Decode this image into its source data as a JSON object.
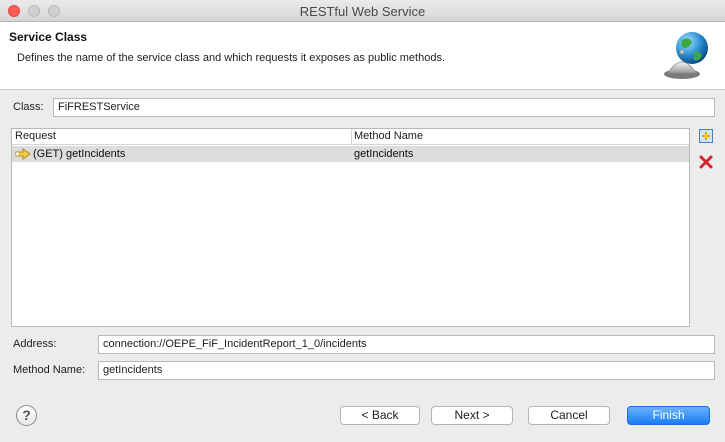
{
  "window": {
    "title": "RESTful Web Service"
  },
  "header": {
    "title": "Service Class",
    "description": "Defines the name of the service class and which requests it exposes as public methods."
  },
  "class_field": {
    "label": "Class:",
    "value": "FiFRESTService"
  },
  "table": {
    "columns": [
      "Request",
      "Method Name"
    ],
    "rows": [
      {
        "request": "(GET) getIncidents",
        "method": "getIncidents"
      }
    ]
  },
  "address_field": {
    "label": "Address:",
    "value": "connection://OEPE_FiF_IncidentReport_1_0/incidents"
  },
  "method_name_field": {
    "label": "Method Name:",
    "value": "getIncidents"
  },
  "buttons": {
    "help": "?",
    "back": "< Back",
    "next": "Next >",
    "cancel": "Cancel",
    "finish": "Finish"
  },
  "colors": {
    "accent": "#197cf6",
    "close": "#ff5f57",
    "selected_row": "#dcdcdc"
  }
}
